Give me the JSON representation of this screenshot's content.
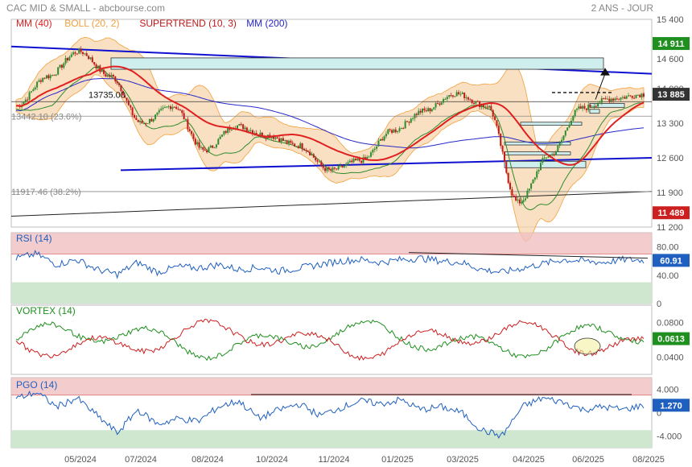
{
  "header": {
    "title": "CAC MID & SMALL - abcbourse.com",
    "period": "2 ANS - JOUR"
  },
  "colors": {
    "background": "#ffffff",
    "ma40": "#e02020",
    "boll": "#f2a03c",
    "supertrend_up": "#2e8b2e",
    "supertrend_down": "#c01818",
    "ma200": "#2727c8",
    "trendline": "#1010d0",
    "rsi": "#1f5fbf",
    "vortex_plus": "#1f8f1f",
    "vortex_minus": "#cc1f1f",
    "pgo": "#1f5fbf",
    "zone_high": "#f0c0c0",
    "zone_low": "#cfe6cf",
    "resistance_box": "#cfeeee"
  },
  "chart_data": [
    {
      "type": "line",
      "panel": "price",
      "legend": [
        {
          "label": "MM (40)",
          "color": "#e02020"
        },
        {
          "label": "BOLL (20, 2)",
          "color": "#f2a03c"
        },
        {
          "label": "SUPERTREND (10, 3)",
          "color": "#c01818"
        },
        {
          "label": "MM (200)",
          "color": "#2727c8"
        }
      ],
      "ylim": [
        11200,
        15400
      ],
      "y_ticks": [
        "15 400",
        "14 600",
        "14 000",
        "13 300",
        "12 600",
        "11 900",
        "11 200"
      ],
      "x_ticks": [
        "05/2024",
        "07/2024",
        "08/2024",
        "10/2024",
        "11/2024",
        "01/2025",
        "03/2025",
        "04/2025",
        "06/2025",
        "08/2025"
      ],
      "x_range": [
        "2024-03",
        "2025-08"
      ],
      "labels": [
        {
          "text": "13735.00",
          "value": 13735
        },
        {
          "text": "13442.10 (23.6%)",
          "value": 13442
        },
        {
          "text": "11917.46 (38.2%)",
          "value": 11917
        }
      ],
      "price_tags": [
        {
          "text": "14 911",
          "value": 14911,
          "color": "#1f8f1f"
        },
        {
          "text": "13 885",
          "value": 13885,
          "color": "#333333"
        },
        {
          "text": "11 489",
          "value": 11489,
          "color": "#cc1f1f"
        }
      ],
      "close_series": [
        {
          "date": "2024-03",
          "value": 13650
        },
        {
          "date": "2024-04",
          "value": 14250
        },
        {
          "date": "2024-05",
          "value": 14750
        },
        {
          "date": "2024-06",
          "value": 14250
        },
        {
          "date": "2024-06b",
          "value": 13300
        },
        {
          "date": "2024-07",
          "value": 13650
        },
        {
          "date": "2024-08",
          "value": 12750
        },
        {
          "date": "2024-08b",
          "value": 13250
        },
        {
          "date": "2024-09",
          "value": 13050
        },
        {
          "date": "2024-10",
          "value": 12850
        },
        {
          "date": "2024-11",
          "value": 12350
        },
        {
          "date": "2024-12",
          "value": 12550
        },
        {
          "date": "2025-01",
          "value": 13150
        },
        {
          "date": "2025-02",
          "value": 13550
        },
        {
          "date": "2025-03",
          "value": 13900
        },
        {
          "date": "2025-03b",
          "value": 13650
        },
        {
          "date": "2025-04",
          "value": 11700
        },
        {
          "date": "2025-04b",
          "value": 12650
        },
        {
          "date": "2025-05",
          "value": 13600
        },
        {
          "date": "2025-06",
          "value": 13800
        },
        {
          "date": "2025-07",
          "value": 13885
        }
      ]
    },
    {
      "type": "line",
      "panel": "rsi",
      "legend": [
        {
          "label": "RSI (14)",
          "color": "#1f5fbf"
        }
      ],
      "ylim": [
        0,
        100
      ],
      "y_ticks": [
        "80.00",
        "40.00",
        "0"
      ],
      "current_label": "60.91",
      "current_value": 60.91,
      "values": [
        64,
        70,
        55,
        62,
        48,
        41,
        58,
        44,
        52,
        50,
        55,
        48,
        51,
        46,
        50,
        55,
        60,
        62,
        58,
        62,
        64,
        60,
        58,
        48,
        44,
        50,
        56,
        62,
        60,
        58,
        62,
        60.91
      ]
    },
    {
      "type": "line",
      "panel": "vortex",
      "legend": [
        {
          "label": "VORTEX (14)",
          "color": "#1f8f1f"
        }
      ],
      "y_ticks": [
        "0.0800",
        "0.0400"
      ],
      "current_label": "0.0613",
      "current_value": 0.0613
    },
    {
      "type": "line",
      "panel": "pgo",
      "legend": [
        {
          "label": "PGO (14)",
          "color": "#1f5fbf"
        }
      ],
      "y_ticks": [
        "4.000",
        "0",
        "-4.000"
      ],
      "current_label": "1.270",
      "current_value": 1.27,
      "values": [
        2.4,
        3.5,
        1.0,
        2.5,
        -0.5,
        -3.5,
        0.5,
        -2.0,
        -1.0,
        -1.5,
        1.0,
        2.0,
        -1.0,
        0.5,
        1.5,
        -0.5,
        0.8,
        2.0,
        1.5,
        2.2,
        0.5,
        1.0,
        0.0,
        -3.0,
        -4.0,
        1.0,
        2.5,
        1.8,
        0.5,
        1.0,
        0.5,
        1.27
      ]
    }
  ]
}
